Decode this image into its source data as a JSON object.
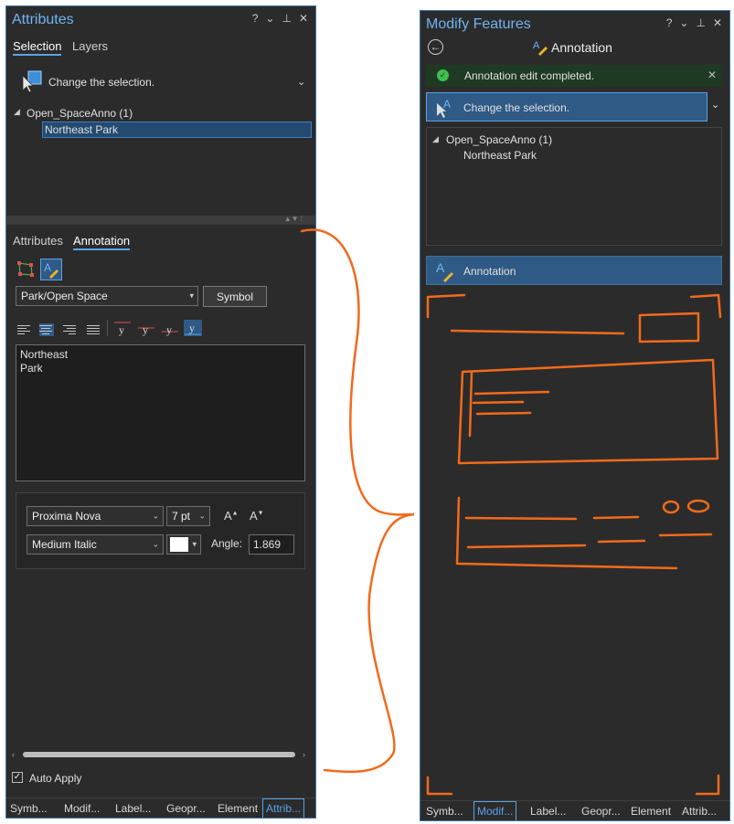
{
  "left": {
    "title": "Attributes",
    "header_icons": [
      "?",
      "⌄",
      "⊥",
      "✕"
    ],
    "tabs": [
      "Selection",
      "Layers"
    ],
    "change_selection": "Change the selection.",
    "tree": {
      "layer": "Open_SpaceAnno (1)",
      "feature": "Northeast Park"
    },
    "sub_tabs": [
      "Attributes",
      "Annotation"
    ],
    "class_select": "Park/Open Space",
    "symbol_button": "Symbol",
    "text_value": "Northeast\nPark",
    "font": "Proxima Nova",
    "size": "7 pt",
    "style": "Medium Italic",
    "angle_label": "Angle:",
    "angle_value": "1.869",
    "auto_apply": "Auto Apply",
    "bottom_tabs": [
      "Symb...",
      "Modif...",
      "Label...",
      "Geopr...",
      "Element",
      "Attrib..."
    ]
  },
  "right": {
    "title": "Modify Features",
    "header_icons": [
      "?",
      "⌄",
      "⊥",
      "✕"
    ],
    "breadcrumb": "Annotation",
    "notice": "Annotation edit completed.",
    "change_selection": "Change the selection.",
    "tree": {
      "layer": "Open_SpaceAnno (1)",
      "feature": "Northeast Park"
    },
    "annotation_bar": "Annotation",
    "bottom_tabs": [
      "Symb...",
      "Modif...",
      "Label...",
      "Geopr...",
      "Element",
      "Attrib..."
    ]
  },
  "colors": {
    "accent": "#5aa3e8",
    "sketch": "#f26a1b",
    "success": "#3fbf4f",
    "panel": "#2b2b2b"
  }
}
